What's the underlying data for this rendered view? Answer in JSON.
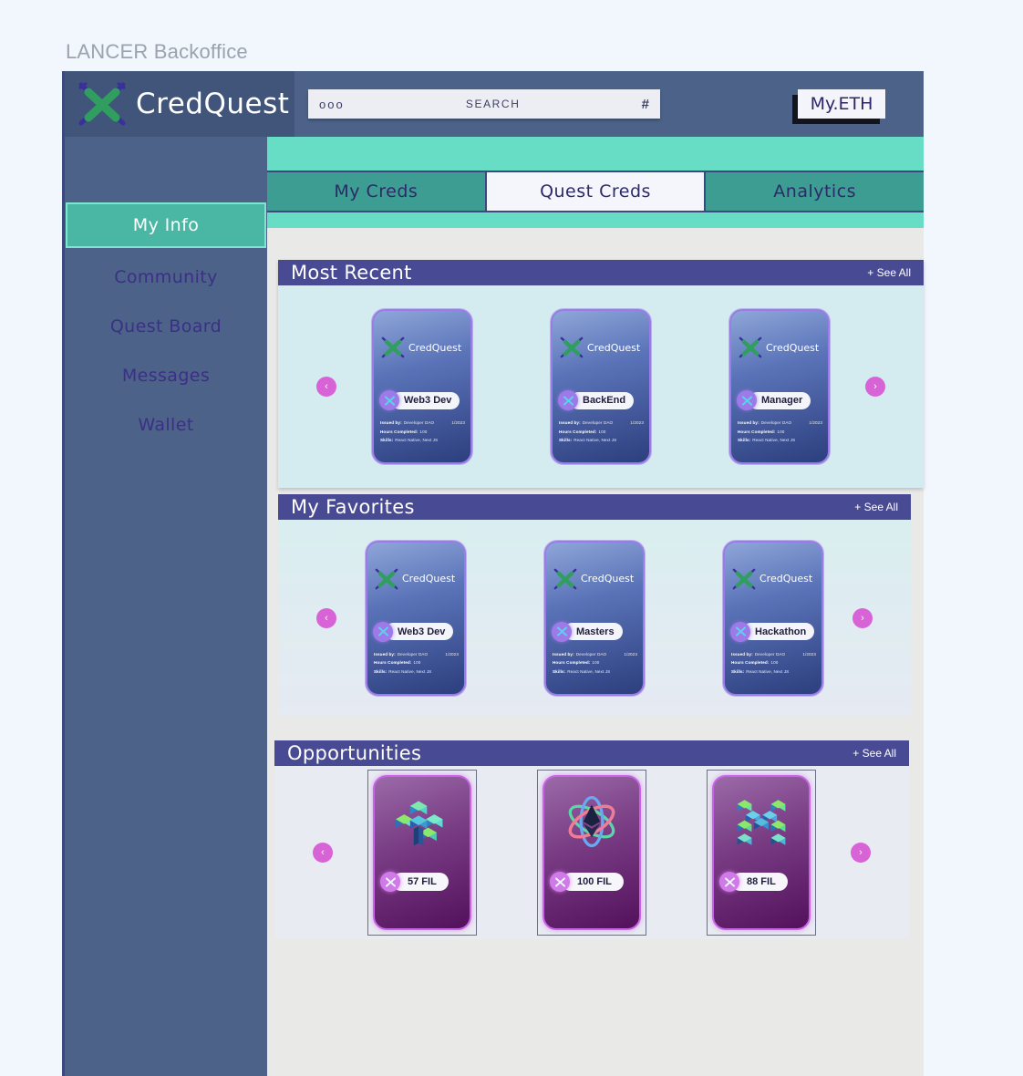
{
  "page_title": "LANCER Backoffice",
  "header": {
    "brand": "CredQuest",
    "logo_icon": "crossed-swords-logo-icon",
    "search": {
      "dots": "ooo",
      "placeholder": "SEARCH",
      "hash": "#",
      "value": ""
    },
    "wallet_button": "My.ETH"
  },
  "sidebar": {
    "items": [
      {
        "label": "My Info",
        "active": true
      },
      {
        "label": "Community",
        "active": false
      },
      {
        "label": "Quest Board",
        "active": false
      },
      {
        "label": "Messages",
        "active": false
      },
      {
        "label": "Wallet",
        "active": false
      }
    ]
  },
  "tabs": [
    {
      "label": "My Creds",
      "active": false
    },
    {
      "label": "Quest Creds",
      "active": true
    },
    {
      "label": "Analytics",
      "active": false
    }
  ],
  "labels": {
    "see_all": "+ See All",
    "arrow_left": "‹",
    "arrow_right": "›",
    "issued_by": "Issued by:",
    "hours_completed": "Hours Completed:",
    "skills": "Skills:"
  },
  "colors": {
    "header_bg": "#4c6288",
    "sidebar_bg": "#4c6288",
    "accent_teal": "#68ddc6",
    "accent_teal_dark": "#3e9d92",
    "panel_header": "#494a94",
    "arrow_pink": "#d763d7",
    "card_purple_border": "#9b7be8",
    "opp_magenta": "#c964e8"
  },
  "sections": [
    {
      "id": "most-recent",
      "title": "Most Recent",
      "cards": [
        {
          "brand": "CredQuest",
          "badge": "Web3 Dev",
          "issuer": "Developer DAO",
          "date": "1/2023",
          "hours": "100",
          "skills": "React Native, Next JS"
        },
        {
          "brand": "CredQuest",
          "badge": "BackEnd",
          "issuer": "Developer DAO",
          "date": "1/2023",
          "hours": "100",
          "skills": "React Native, Next JS"
        },
        {
          "brand": "CredQuest",
          "badge": "Manager",
          "issuer": "Developer DAO",
          "date": "1/2023",
          "hours": "100",
          "skills": "React Native, Next JS"
        }
      ]
    },
    {
      "id": "my-favorites",
      "title": "My Favorites",
      "cards": [
        {
          "brand": "CredQuest",
          "badge": "Web3 Dev",
          "issuer": "Developer DAO",
          "date": "1/2023",
          "hours": "100",
          "skills": "React Native, Next JS"
        },
        {
          "brand": "CredQuest",
          "badge": "Masters",
          "issuer": "Developer DAO",
          "date": "1/2023",
          "hours": "100",
          "skills": "React Native, Next JS"
        },
        {
          "brand": "CredQuest",
          "badge": "Hackathon",
          "issuer": "Developer DAO",
          "date": "1/2023",
          "hours": "100",
          "skills": "React Native, Next JS"
        }
      ]
    }
  ],
  "opportunities": {
    "id": "opportunities",
    "title": "Opportunities",
    "cards": [
      {
        "art_icon": "isometric-tree-blocks-icon",
        "amount": "57 FIL"
      },
      {
        "art_icon": "ethereum-atom-icon",
        "amount": "100 FIL"
      },
      {
        "art_icon": "isometric-h-blocks-icon",
        "amount": "88 FIL"
      }
    ]
  }
}
